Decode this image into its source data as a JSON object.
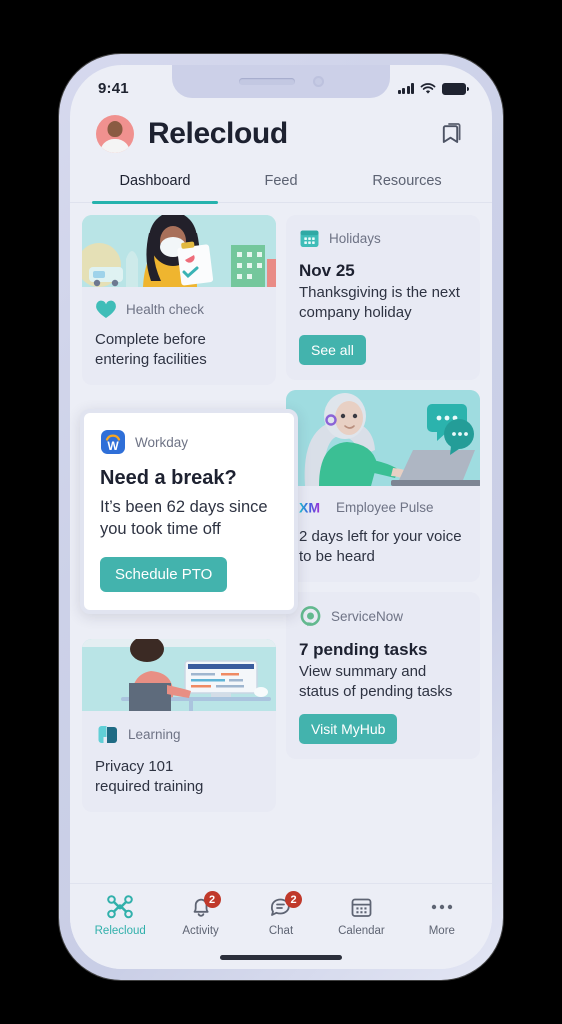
{
  "status_bar": {
    "time": "9:41",
    "signal_icon": "cellular-signal-icon",
    "wifi_icon": "wifi-icon",
    "battery_icon": "battery-icon"
  },
  "header": {
    "avatar": "user-avatar",
    "title": "Relecloud",
    "bookmark_icon": "bookmark-icon"
  },
  "tabs": [
    {
      "label": "Dashboard",
      "active": true
    },
    {
      "label": "Feed",
      "active": false
    },
    {
      "label": "Resources",
      "active": false
    }
  ],
  "cards": {
    "health_check": {
      "source": "Health check",
      "source_icon": "heart-icon",
      "text": "Complete before entering facilities",
      "illustration": "woman-with-mask-holding-checklist"
    },
    "holidays": {
      "source": "Holidays",
      "source_icon": "calendar-icon",
      "headline": "Nov 25",
      "text": "Thanksgiving is the next company holiday",
      "button": "See all"
    },
    "workday": {
      "source": "Workday",
      "source_icon": "workday-logo-icon",
      "headline": "Need a break?",
      "text": "It’s been 62 days since you took time off",
      "button": "Schedule PTO"
    },
    "employee_pulse": {
      "source": "Employee Pulse",
      "source_icon": "xm-logo-icon",
      "text": "2 days left for your voice to be heard",
      "illustration": "woman-at-laptop-with-chat-bubbles"
    },
    "service_now": {
      "source": "ServiceNow",
      "source_icon": "servicenow-logo-icon",
      "headline": "7 pending tasks",
      "text": "View summary and status of pending tasks",
      "button": "Visit MyHub"
    },
    "learning": {
      "source": "Learning",
      "source_icon": "learning-logo-icon",
      "text_line1": "Privacy 101",
      "text_line2": "required training",
      "illustration": "person-standing-at-desk-with-monitor"
    }
  },
  "bottom_nav": [
    {
      "label": "Relecloud",
      "icon": "drone-icon",
      "active": true,
      "badge": ""
    },
    {
      "label": "Activity",
      "icon": "bell-icon",
      "active": false,
      "badge": "2"
    },
    {
      "label": "Chat",
      "icon": "chat-bubble-icon",
      "active": false,
      "badge": "2"
    },
    {
      "label": "Calendar",
      "icon": "calendar-icon",
      "active": false,
      "badge": ""
    },
    {
      "label": "More",
      "icon": "ellipsis-icon",
      "active": false,
      "badge": ""
    }
  ],
  "colors": {
    "accent_teal": "#26b2ad",
    "button_teal": "#43b3ad",
    "badge_red": "#c0392b",
    "screen_bg": "#eceef6",
    "card_bg": "#e8eaf4",
    "frame": "#ccd1e8"
  }
}
